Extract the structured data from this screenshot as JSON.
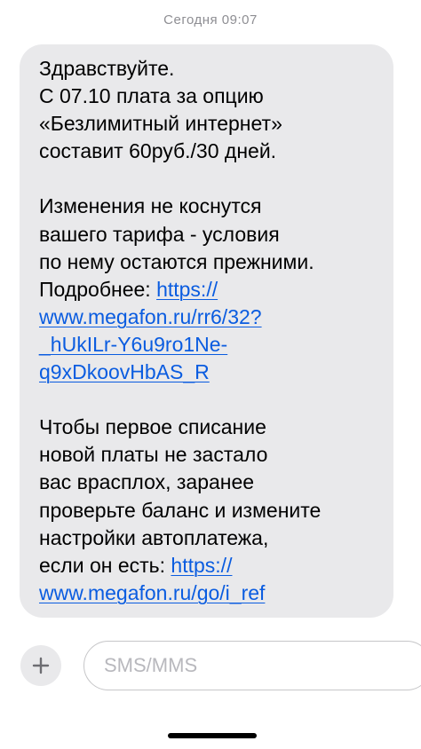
{
  "header": {
    "timestamp": "Сегодня 09:07"
  },
  "message": {
    "lines": [
      {
        "segments": [
          {
            "text": "Здравствуйте."
          }
        ]
      },
      {
        "segments": [
          {
            "text": "С 07.10 плата за опцию"
          }
        ]
      },
      {
        "segments": [
          {
            "text": "«Безлимитный интернет»"
          }
        ]
      },
      {
        "segments": [
          {
            "text": "составит 60руб./30 дней."
          }
        ]
      },
      {
        "segments": []
      },
      {
        "segments": [
          {
            "text": "Изменения не коснутся"
          }
        ]
      },
      {
        "segments": [
          {
            "text": "вашего тарифа - условия"
          }
        ]
      },
      {
        "segments": [
          {
            "text": "по нему остаются прежними."
          }
        ]
      },
      {
        "segments": [
          {
            "text": "Подробнее: "
          },
          {
            "text": "https://",
            "link": true
          }
        ]
      },
      {
        "segments": [
          {
            "text": "www.megafon.ru/rr6/32?",
            "link": true
          }
        ]
      },
      {
        "segments": [
          {
            "text": "_hUkILr-Y6u9ro1Ne-",
            "link": true
          }
        ]
      },
      {
        "segments": [
          {
            "text": "q9xDkoovHbAS_R",
            "link": true
          }
        ]
      },
      {
        "segments": []
      },
      {
        "segments": [
          {
            "text": "Чтобы первое списание"
          }
        ]
      },
      {
        "segments": [
          {
            "text": "новой платы не застало"
          }
        ]
      },
      {
        "segments": [
          {
            "text": "вас врасплох, заранее"
          }
        ]
      },
      {
        "segments": [
          {
            "text": "проверьте баланс и измените"
          }
        ]
      },
      {
        "segments": [
          {
            "text": "настройки автоплатежа,"
          }
        ]
      },
      {
        "segments": [
          {
            "text": "если он есть: "
          },
          {
            "text": "https://",
            "link": true
          }
        ]
      },
      {
        "segments": [
          {
            "text": "www.megafon.ru/go/i_ref",
            "link": true
          }
        ]
      }
    ]
  },
  "composer": {
    "add_icon": "plus-icon",
    "placeholder": "SMS/MMS",
    "value": ""
  },
  "colors": {
    "bubble": "#e9e9eb",
    "link": "#0a5ce0",
    "timestamp": "#8e8e93"
  }
}
